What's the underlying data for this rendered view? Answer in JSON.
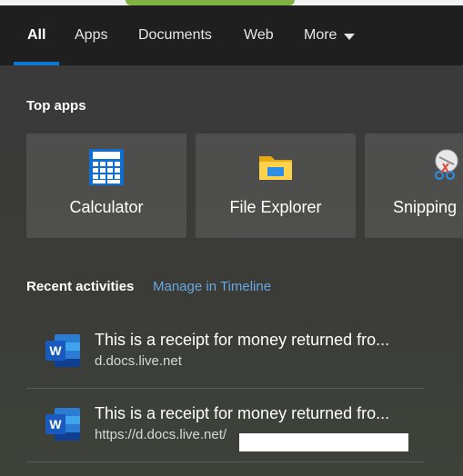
{
  "tabs": [
    {
      "label": "All",
      "active": true
    },
    {
      "label": "Apps"
    },
    {
      "label": "Documents"
    },
    {
      "label": "Web"
    },
    {
      "label": "More"
    }
  ],
  "top_apps": {
    "title": "Top apps",
    "items": [
      {
        "label": "Calculator",
        "icon": "calculator-icon"
      },
      {
        "label": "File Explorer",
        "icon": "folder-icon"
      },
      {
        "label": "Snipping",
        "icon": "snipping-tool-icon"
      }
    ]
  },
  "recent": {
    "title": "Recent activities",
    "manage_link": "Manage in Timeline",
    "items": [
      {
        "title": "This is a receipt for money returned fro...",
        "subtitle": "d.docs.live.net",
        "icon": "word-icon"
      },
      {
        "title": "This is a receipt for money returned fro...",
        "subtitle": "https://d.docs.live.net/",
        "icon": "word-icon"
      }
    ]
  },
  "colors": {
    "accent": "#0a78d4",
    "link": "#69a7e0",
    "word_blue": "#185abd"
  }
}
